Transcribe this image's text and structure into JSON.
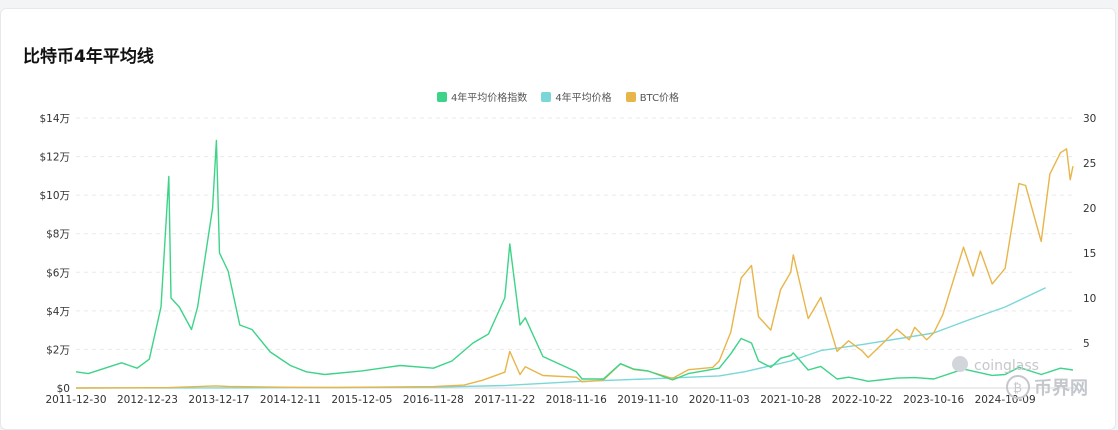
{
  "page": {
    "title": "比特币4年平均线"
  },
  "watermark": {
    "brand": "coinglass",
    "site": "币界网"
  },
  "colors": {
    "index": "#3dd388",
    "average": "#79d7d7",
    "btc": "#e8b54a",
    "grid": "#e9e9e9"
  },
  "chart_data": {
    "type": "line",
    "title": "比特币4年平均线",
    "legend": {
      "placement": "top-center",
      "entries": [
        "4年平均价格指数",
        "4年平均价格",
        "BTC价格"
      ]
    },
    "grid": true,
    "y_left": {
      "ticks": [
        "$0",
        "$2万",
        "$4万",
        "$6万",
        "$8万",
        "$10万",
        "$12万",
        "$14万"
      ],
      "range": [
        0,
        140000
      ]
    },
    "y_right": {
      "ticks": [
        "5",
        "10",
        "15",
        "20",
        "25",
        "30"
      ],
      "range": [
        0,
        30
      ]
    },
    "x_ticks": [
      "2011-12-30",
      "2012-12-23",
      "2013-12-17",
      "2014-12-11",
      "2015-12-05",
      "2016-11-28",
      "2017-11-22",
      "2018-11-16",
      "2019-11-10",
      "2020-11-03",
      "2021-10-28",
      "2022-10-22",
      "2023-10-16",
      "2024-10-09"
    ],
    "series": [
      {
        "name": "4年平均价格",
        "axis": "left",
        "points": [
          [
            "2011-12-30",
            0
          ],
          [
            "2013-12-17",
            60
          ],
          [
            "2014-12-11",
            200
          ],
          [
            "2015-12-05",
            300
          ],
          [
            "2016-11-28",
            420
          ],
          [
            "2017-11-22",
            1300
          ],
          [
            "2018-11-16",
            3300
          ],
          [
            "2019-11-10",
            4700
          ],
          [
            "2020-11-03",
            6300
          ],
          [
            "2021-03-15",
            8500
          ],
          [
            "2021-10-28",
            14000
          ],
          [
            "2022-04-01",
            19500
          ],
          [
            "2022-10-22",
            22500
          ],
          [
            "2023-10-16",
            28500
          ],
          [
            "2024-04-01",
            35000
          ],
          [
            "2024-10-09",
            42000
          ],
          [
            "2025-05-01",
            52000
          ]
        ]
      },
      {
        "name": "BTC价格",
        "axis": "left",
        "points": [
          [
            "2011-12-30",
            5
          ],
          [
            "2013-04-10",
            200
          ],
          [
            "2013-12-01",
            1100
          ],
          [
            "2014-02-01",
            800
          ],
          [
            "2014-12-11",
            350
          ],
          [
            "2015-08-01",
            250
          ],
          [
            "2015-12-05",
            400
          ],
          [
            "2016-11-28",
            750
          ],
          [
            "2017-05-01",
            1500
          ],
          [
            "2017-08-01",
            4000
          ],
          [
            "2017-11-22",
            8200
          ],
          [
            "2017-12-17",
            19000
          ],
          [
            "2018-02-06",
            7000
          ],
          [
            "2018-03-05",
            11000
          ],
          [
            "2018-06-01",
            6500
          ],
          [
            "2018-11-16",
            5600
          ],
          [
            "2018-12-15",
            3200
          ],
          [
            "2019-04-01",
            4100
          ],
          [
            "2019-06-26",
            12500
          ],
          [
            "2019-09-01",
            9600
          ],
          [
            "2019-11-10",
            8800
          ],
          [
            "2020-03-13",
            5000
          ],
          [
            "2020-06-01",
            9500
          ],
          [
            "2020-10-01",
            10700
          ],
          [
            "2020-11-03",
            14000
          ],
          [
            "2020-12-31",
            29000
          ],
          [
            "2021-02-21",
            57000
          ],
          [
            "2021-04-14",
            63500
          ],
          [
            "2021-05-19",
            37000
          ],
          [
            "2021-07-20",
            30000
          ],
          [
            "2021-09-07",
            51000
          ],
          [
            "2021-10-28",
            60000
          ],
          [
            "2021-11-10",
            69000
          ],
          [
            "2022-01-24",
            36000
          ],
          [
            "2022-03-28",
            47000
          ],
          [
            "2022-06-18",
            19000
          ],
          [
            "2022-08-15",
            24500
          ],
          [
            "2022-10-22",
            19200
          ],
          [
            "2022-11-21",
            15800
          ],
          [
            "2023-02-01",
            23000
          ],
          [
            "2023-04-14",
            30500
          ],
          [
            "2023-06-15",
            25000
          ],
          [
            "2023-07-13",
            31500
          ],
          [
            "2023-09-11",
            25000
          ],
          [
            "2023-10-16",
            28500
          ],
          [
            "2023-12-01",
            38000
          ],
          [
            "2024-03-14",
            73000
          ],
          [
            "2024-05-01",
            58000
          ],
          [
            "2024-06-07",
            71000
          ],
          [
            "2024-08-05",
            54000
          ],
          [
            "2024-10-09",
            62000
          ],
          [
            "2024-12-17",
            106000
          ],
          [
            "2025-01-20",
            105000
          ],
          [
            "2025-04-08",
            76000
          ],
          [
            "2025-05-22",
            111000
          ],
          [
            "2025-07-14",
            122000
          ],
          [
            "2025-08-14",
            124000
          ],
          [
            "2025-09-01",
            108000
          ],
          [
            "2025-09-15",
            115000
          ]
        ]
      },
      {
        "name": "4年平均价格指数",
        "axis": "right",
        "points": [
          [
            "2011-12-30",
            1.8
          ],
          [
            "2012-03-01",
            1.6
          ],
          [
            "2012-08-15",
            2.8
          ],
          [
            "2012-11-01",
            2.2
          ],
          [
            "2013-01-01",
            3.2
          ],
          [
            "2013-03-01",
            9.0
          ],
          [
            "2013-04-09",
            23.5
          ],
          [
            "2013-04-20",
            10.0
          ],
          [
            "2013-06-01",
            9.0
          ],
          [
            "2013-08-01",
            6.5
          ],
          [
            "2013-09-01",
            9.0
          ],
          [
            "2013-11-15",
            20.0
          ],
          [
            "2013-12-04",
            27.5
          ],
          [
            "2013-12-20",
            15.0
          ],
          [
            "2014-02-01",
            13.0
          ],
          [
            "2014-04-01",
            7.0
          ],
          [
            "2014-06-01",
            6.5
          ],
          [
            "2014-09-01",
            4.0
          ],
          [
            "2014-12-11",
            2.5
          ],
          [
            "2015-03-01",
            1.8
          ],
          [
            "2015-06-01",
            1.5
          ],
          [
            "2015-12-05",
            1.9
          ],
          [
            "2016-06-15",
            2.5
          ],
          [
            "2016-11-28",
            2.2
          ],
          [
            "2017-03-01",
            3.0
          ],
          [
            "2017-06-15",
            5.0
          ],
          [
            "2017-09-01",
            6.0
          ],
          [
            "2017-11-22",
            10.0
          ],
          [
            "2017-12-17",
            16.0
          ],
          [
            "2018-02-06",
            7.0
          ],
          [
            "2018-03-05",
            7.8
          ],
          [
            "2018-06-01",
            3.5
          ],
          [
            "2018-11-16",
            1.8
          ],
          [
            "2018-12-15",
            1.0
          ],
          [
            "2019-04-01",
            1.0
          ],
          [
            "2019-06-26",
            2.7
          ],
          [
            "2019-09-01",
            2.1
          ],
          [
            "2019-11-10",
            1.9
          ],
          [
            "2020-03-13",
            0.9
          ],
          [
            "2020-06-01",
            1.6
          ],
          [
            "2020-11-03",
            2.2
          ],
          [
            "2020-12-31",
            3.8
          ],
          [
            "2021-02-21",
            5.5
          ],
          [
            "2021-04-14",
            5.0
          ],
          [
            "2021-05-19",
            3.0
          ],
          [
            "2021-07-20",
            2.3
          ],
          [
            "2021-09-07",
            3.3
          ],
          [
            "2021-10-28",
            3.6
          ],
          [
            "2021-11-10",
            3.9
          ],
          [
            "2022-01-24",
            2.0
          ],
          [
            "2022-03-28",
            2.4
          ],
          [
            "2022-06-18",
            1.0
          ],
          [
            "2022-08-15",
            1.2
          ],
          [
            "2022-10-22",
            0.9
          ],
          [
            "2022-11-21",
            0.75
          ],
          [
            "2023-04-14",
            1.1
          ],
          [
            "2023-07-13",
            1.15
          ],
          [
            "2023-10-16",
            1.0
          ],
          [
            "2024-03-14",
            2.1
          ],
          [
            "2024-08-05",
            1.4
          ],
          [
            "2024-10-09",
            1.5
          ],
          [
            "2024-12-17",
            2.3
          ],
          [
            "2025-04-08",
            1.5
          ],
          [
            "2025-07-14",
            2.2
          ],
          [
            "2025-09-15",
            2.0
          ]
        ]
      }
    ]
  }
}
